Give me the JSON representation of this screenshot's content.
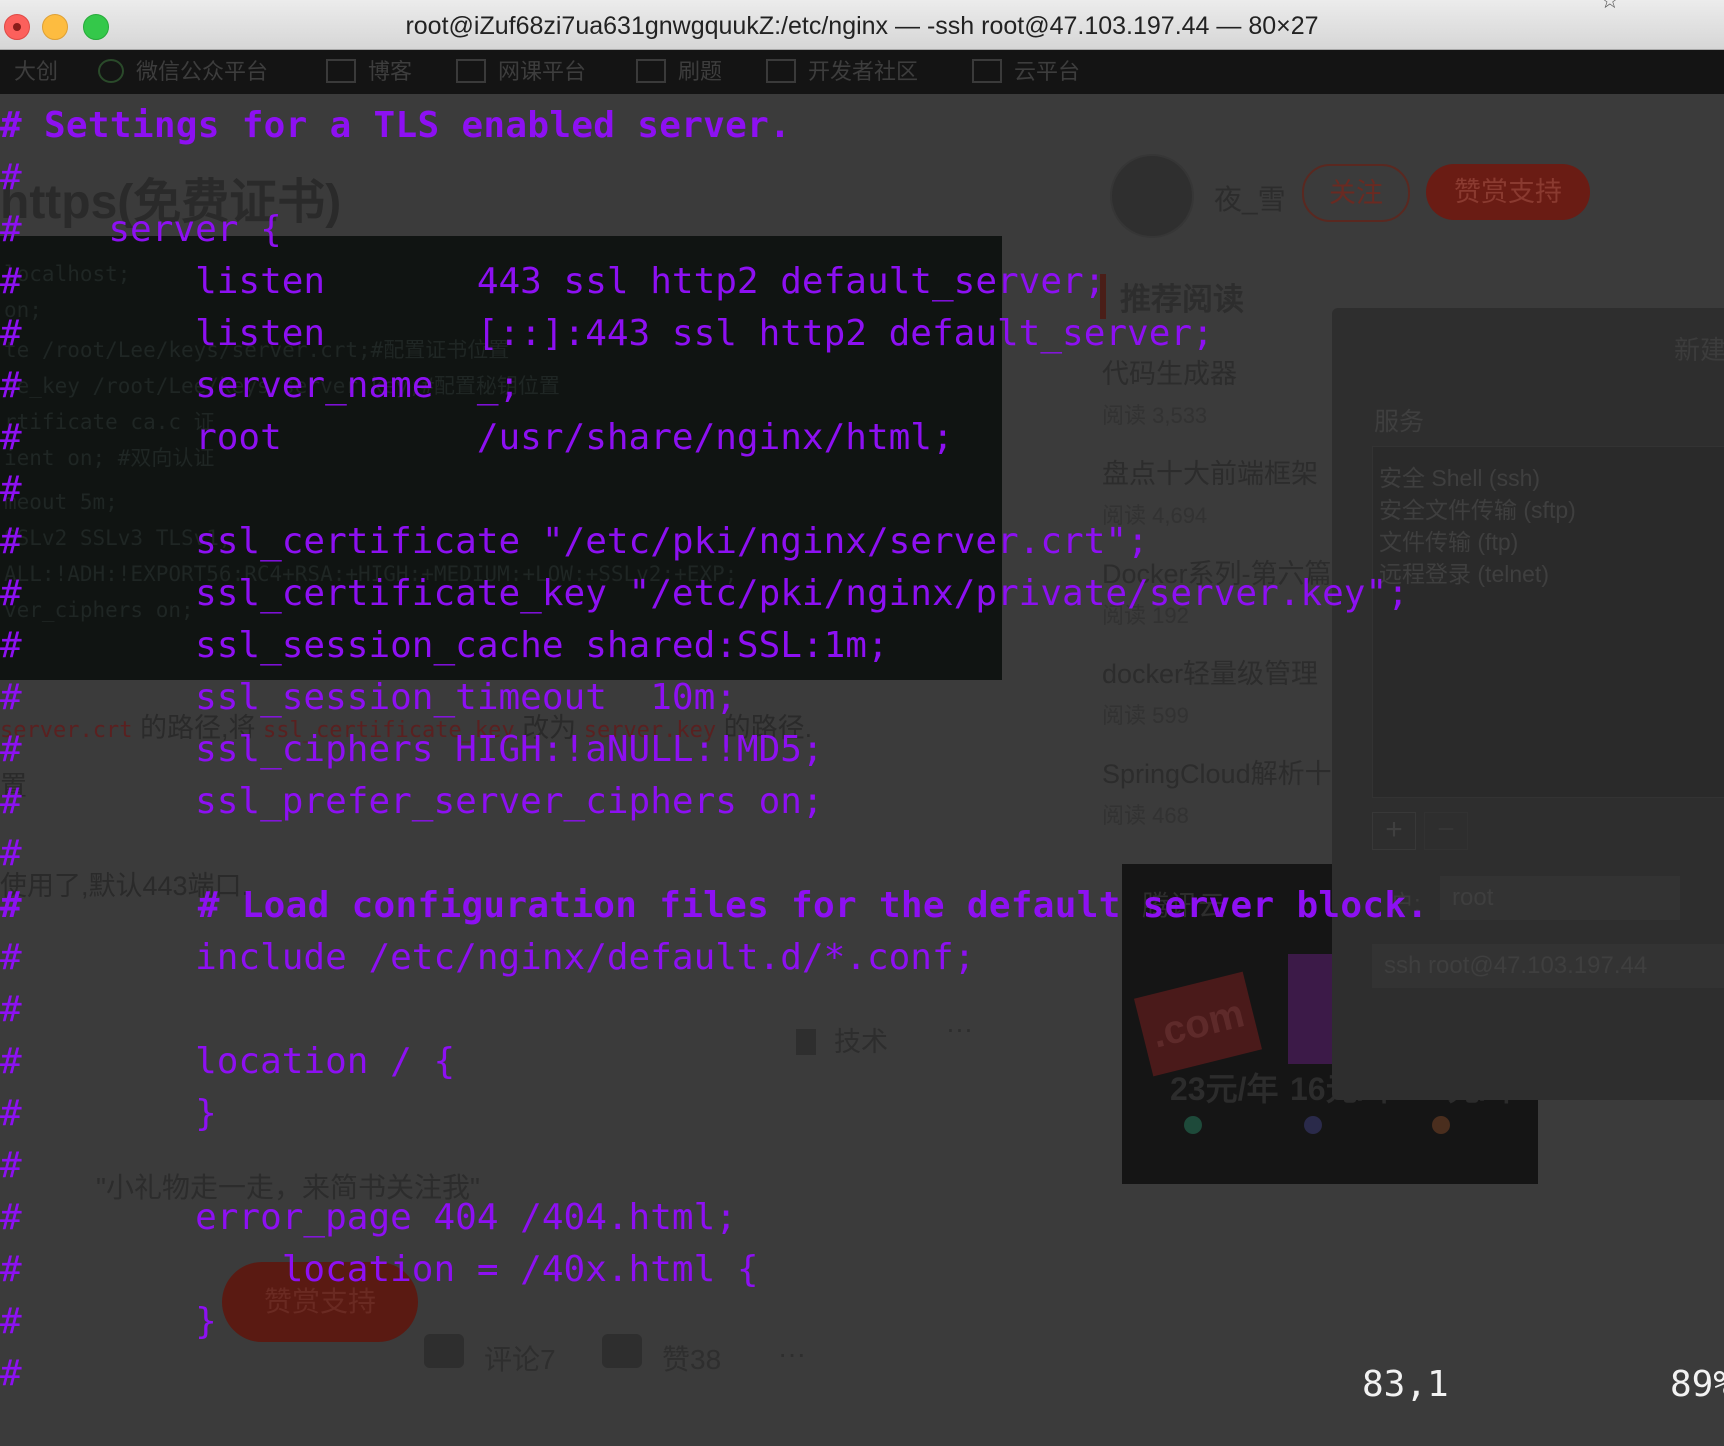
{
  "window": {
    "title": "root@iZuf68zi7ua631gnwgquukZ:/etc/nginx — -ssh root@47.103.197.44 — 80×27"
  },
  "background": {
    "bookmarks": [
      "大创",
      "微信公众平台",
      "博客",
      "网课平台",
      "刷题",
      "开发者社区",
      "云平台"
    ],
    "article_title": "https(免费证书)",
    "code_lines": [
      "localhost;",
      "      on;",
      "te     /root/Lee/keys/server.crt;#配置证书位置",
      "te_key  /root/Lee/keys/server.key;#配置秘钥位置",
      "rtificate ca.c         证",
      "ient on; #双向认证",
      "meout  5m;",
      " SSLv2 SSLv3 TLSv1;",
      "ALL:!ADH:!EXPORT56:RC4+RSA:+HIGH:+MEDIUM:+LOW:+SSLv2:+EXP;",
      "ver_ciphers   on;"
    ],
    "para1_code1": "server.crt",
    "para1_text1": "的路径,将",
    "para1_code2": "ssl_certificate_key",
    "para1_text2": "改为",
    "para1_code3": "server.key",
    "para1_text3": "的路径.",
    "para2": "置",
    "para3": "使用了,默认443端口.",
    "author": {
      "name": "夜_雪",
      "follow": "关注",
      "tip": "赞赏支持"
    },
    "recommend": {
      "heading": "推荐阅读",
      "items": [
        {
          "title": "代码生成器",
          "reads": "阅读 3,533"
        },
        {
          "title": "盘点十大前端框架",
          "reads": "阅读 4,694"
        },
        {
          "title": "Docker系列-第六篇",
          "reads": "阅读 192"
        },
        {
          "title": "docker轻量级管理",
          "reads": "阅读 599"
        },
        {
          "title": "SpringCloud解析十",
          "reads": "阅读 468"
        }
      ]
    },
    "ad": {
      "logo": "腾讯云",
      "card": ".com",
      "prices": [
        "23元/年",
        "16元/年",
        "1元/年"
      ]
    },
    "dialog": {
      "new_label": "新建",
      "services_heading": "服务",
      "services": [
        "安全 Shell (ssh)",
        "安全文件传输 (sftp)",
        "文件传输 (ftp)",
        "远程登录 (telnet)"
      ],
      "plus": "+",
      "minus": "−",
      "user_label": "户:",
      "user_value": "root",
      "command": "ssh root@47.103.197.44"
    },
    "gift_text": "\"小礼物走一走，来简书关注我\"",
    "gift_button": "赞赏支持",
    "tech_tag": "技术",
    "tech_more": "···",
    "footer": {
      "comments": "评论7",
      "likes": "赞38",
      "more": "···"
    }
  },
  "terminal": {
    "lines": [
      "# Settings for a TLS enabled server.",
      "#",
      "#    server {",
      "#        listen       443 ssl http2 default_server;",
      "#        listen       [::]:443 ssl http2 default_server;",
      "#        server_name  _;",
      "#        root         /usr/share/nginx/html;",
      "#",
      "#        ssl_certificate \"/etc/pki/nginx/server.crt\";",
      "#        ssl_certificate_key \"/etc/pki/nginx/private/server.key\";",
      "#        ssl_session_cache shared:SSL:1m;",
      "#        ssl_session_timeout  10m;",
      "#        ssl_ciphers HIGH:!aNULL:!MD5;",
      "#        ssl_prefer_server_ciphers on;",
      "#",
      "#        # Load configuration files for the default server block.",
      "#        include /etc/nginx/default.d/*.conf;",
      "#",
      "#        location / {",
      "#        }",
      "#",
      "#        error_page 404 /404.html;",
      "#            location = /40x.html {",
      "#        }",
      "#"
    ],
    "status_position": "83,1",
    "status_percent": "89%"
  }
}
